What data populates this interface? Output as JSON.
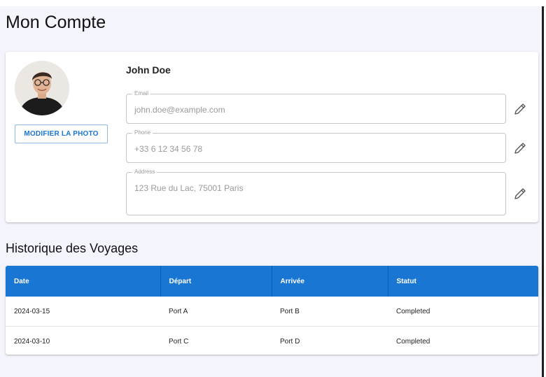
{
  "page": {
    "title": "Mon Compte"
  },
  "profile": {
    "name": "John Doe",
    "photo_button": "MODIFIER LA PHOTO",
    "fields": [
      {
        "label": "Email",
        "value": "john.doe@example.com",
        "icon": "pencil-icon"
      },
      {
        "label": "Phone",
        "value": "+33 6 12 34 56 78",
        "icon": "pencil-icon"
      },
      {
        "label": "Address",
        "value": "123 Rue du Lac, 75001 Paris",
        "icon": "pencil-icon"
      }
    ]
  },
  "history": {
    "title": "Historique des Voyages",
    "columns": [
      "Date",
      "Départ",
      "Arrivée",
      "Statut"
    ],
    "rows": [
      [
        "2024-03-15",
        "Port A",
        "Port B",
        "Completed"
      ],
      [
        "2024-03-10",
        "Port C",
        "Port D",
        "Completed"
      ]
    ]
  },
  "colors": {
    "accent": "#1976d2",
    "background": "#f4f4fc"
  }
}
